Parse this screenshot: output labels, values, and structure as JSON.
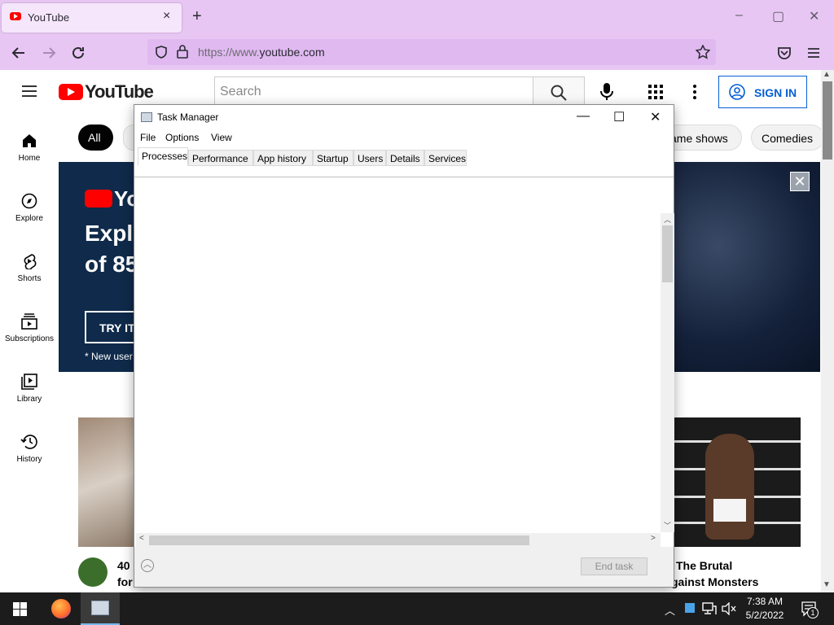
{
  "browser": {
    "tab_title": "YouTube",
    "tab_close": "×",
    "new_tab": "+",
    "url_prefix": "https://www.",
    "url_domain": "youtube.com",
    "win_minimize": "–",
    "win_maximize": "▢",
    "win_close": "✕"
  },
  "youtube": {
    "logo_text": "YouTube",
    "search_placeholder": "Search",
    "sign_in": "SIGN IN",
    "sidebar": [
      {
        "label": "Home",
        "icon": "home-icon"
      },
      {
        "label": "Explore",
        "icon": "compass-icon"
      },
      {
        "label": "Shorts",
        "icon": "shorts-icon"
      },
      {
        "label": "Subscriptions",
        "icon": "subscriptions-icon"
      },
      {
        "label": "Library",
        "icon": "library-icon"
      },
      {
        "label": "History",
        "icon": "history-icon"
      }
    ],
    "chips": [
      "All",
      "ame shows",
      "Comedies"
    ],
    "banner": {
      "logo_partial": "Yo",
      "headline_line1": "Explo",
      "headline_line2": "of 85",
      "cta": "TRY IT",
      "footnote": "* New user",
      "close": "✕"
    },
    "videos": [
      {
        "title_line1": "40",
        "title_line2": "for"
      },
      {
        "title_line1": "The Brutal",
        "title_line2": "gainst Monsters"
      }
    ]
  },
  "task_manager": {
    "title": "Task Manager",
    "minimize": "—",
    "maximize": "☐",
    "close": "✕",
    "menu": [
      "File",
      "Options",
      "View"
    ],
    "tabs": [
      "Processes",
      "Performance",
      "App history",
      "Startup",
      "Users",
      "Details",
      "Services"
    ],
    "active_tab": "Processes",
    "fewer_details_icon": "chevron-up-icon",
    "end_task": "End task"
  },
  "taskbar": {
    "time": "7:38 AM",
    "date": "5/2/2022",
    "notification_count": "1"
  },
  "colors": {
    "browser_chrome": "#e8c6f3",
    "youtube_red": "#ff0000",
    "signin_blue": "#065fd4",
    "banner_bg": "#0f2a4a",
    "taskbar": "#1c1c1c"
  }
}
